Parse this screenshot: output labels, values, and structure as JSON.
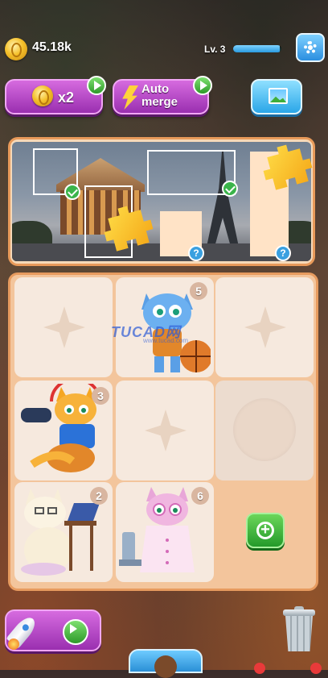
{
  "top_bar": {
    "coins": "45.18k",
    "level": "Lv. 3",
    "level_progress": 0.97,
    "settings_icon": "gear-icon"
  },
  "actions": {
    "double_coins_label": "x2",
    "auto_merge_line1": "Auto",
    "auto_merge_line2": "merge",
    "gallery_icon": "picture-icon"
  },
  "puzzle": {
    "placed_markers": [
      "✓",
      "✓"
    ],
    "missing_markers": [
      "?",
      "?"
    ]
  },
  "board": {
    "badges": {
      "blue_cat": "5",
      "orange_cat": "3",
      "white_cat": "2",
      "pink_cat": "6"
    }
  },
  "watermark": {
    "text": "TUCAD网",
    "sub": "www.tucad.com"
  },
  "colors": {
    "accent_purple": "#b040c4",
    "accent_blue": "#2b8fe0",
    "accent_green": "#2e9a2a",
    "board_bg": "#f3c59c"
  }
}
